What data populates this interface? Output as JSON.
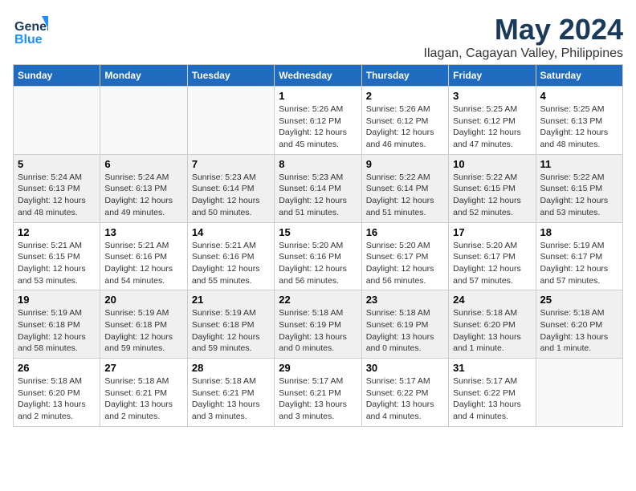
{
  "header": {
    "logo_line1": "General",
    "logo_line2": "Blue",
    "month": "May 2024",
    "location": "Ilagan, Cagayan Valley, Philippines"
  },
  "weekdays": [
    "Sunday",
    "Monday",
    "Tuesday",
    "Wednesday",
    "Thursday",
    "Friday",
    "Saturday"
  ],
  "weeks": [
    [
      {
        "day": "",
        "info": ""
      },
      {
        "day": "",
        "info": ""
      },
      {
        "day": "",
        "info": ""
      },
      {
        "day": "1",
        "info": "Sunrise: 5:26 AM\nSunset: 6:12 PM\nDaylight: 12 hours\nand 45 minutes."
      },
      {
        "day": "2",
        "info": "Sunrise: 5:26 AM\nSunset: 6:12 PM\nDaylight: 12 hours\nand 46 minutes."
      },
      {
        "day": "3",
        "info": "Sunrise: 5:25 AM\nSunset: 6:12 PM\nDaylight: 12 hours\nand 47 minutes."
      },
      {
        "day": "4",
        "info": "Sunrise: 5:25 AM\nSunset: 6:13 PM\nDaylight: 12 hours\nand 48 minutes."
      }
    ],
    [
      {
        "day": "5",
        "info": "Sunrise: 5:24 AM\nSunset: 6:13 PM\nDaylight: 12 hours\nand 48 minutes."
      },
      {
        "day": "6",
        "info": "Sunrise: 5:24 AM\nSunset: 6:13 PM\nDaylight: 12 hours\nand 49 minutes."
      },
      {
        "day": "7",
        "info": "Sunrise: 5:23 AM\nSunset: 6:14 PM\nDaylight: 12 hours\nand 50 minutes."
      },
      {
        "day": "8",
        "info": "Sunrise: 5:23 AM\nSunset: 6:14 PM\nDaylight: 12 hours\nand 51 minutes."
      },
      {
        "day": "9",
        "info": "Sunrise: 5:22 AM\nSunset: 6:14 PM\nDaylight: 12 hours\nand 51 minutes."
      },
      {
        "day": "10",
        "info": "Sunrise: 5:22 AM\nSunset: 6:15 PM\nDaylight: 12 hours\nand 52 minutes."
      },
      {
        "day": "11",
        "info": "Sunrise: 5:22 AM\nSunset: 6:15 PM\nDaylight: 12 hours\nand 53 minutes."
      }
    ],
    [
      {
        "day": "12",
        "info": "Sunrise: 5:21 AM\nSunset: 6:15 PM\nDaylight: 12 hours\nand 53 minutes."
      },
      {
        "day": "13",
        "info": "Sunrise: 5:21 AM\nSunset: 6:16 PM\nDaylight: 12 hours\nand 54 minutes."
      },
      {
        "day": "14",
        "info": "Sunrise: 5:21 AM\nSunset: 6:16 PM\nDaylight: 12 hours\nand 55 minutes."
      },
      {
        "day": "15",
        "info": "Sunrise: 5:20 AM\nSunset: 6:16 PM\nDaylight: 12 hours\nand 56 minutes."
      },
      {
        "day": "16",
        "info": "Sunrise: 5:20 AM\nSunset: 6:17 PM\nDaylight: 12 hours\nand 56 minutes."
      },
      {
        "day": "17",
        "info": "Sunrise: 5:20 AM\nSunset: 6:17 PM\nDaylight: 12 hours\nand 57 minutes."
      },
      {
        "day": "18",
        "info": "Sunrise: 5:19 AM\nSunset: 6:17 PM\nDaylight: 12 hours\nand 57 minutes."
      }
    ],
    [
      {
        "day": "19",
        "info": "Sunrise: 5:19 AM\nSunset: 6:18 PM\nDaylight: 12 hours\nand 58 minutes."
      },
      {
        "day": "20",
        "info": "Sunrise: 5:19 AM\nSunset: 6:18 PM\nDaylight: 12 hours\nand 59 minutes."
      },
      {
        "day": "21",
        "info": "Sunrise: 5:19 AM\nSunset: 6:18 PM\nDaylight: 12 hours\nand 59 minutes."
      },
      {
        "day": "22",
        "info": "Sunrise: 5:18 AM\nSunset: 6:19 PM\nDaylight: 13 hours\nand 0 minutes."
      },
      {
        "day": "23",
        "info": "Sunrise: 5:18 AM\nSunset: 6:19 PM\nDaylight: 13 hours\nand 0 minutes."
      },
      {
        "day": "24",
        "info": "Sunrise: 5:18 AM\nSunset: 6:20 PM\nDaylight: 13 hours\nand 1 minute."
      },
      {
        "day": "25",
        "info": "Sunrise: 5:18 AM\nSunset: 6:20 PM\nDaylight: 13 hours\nand 1 minute."
      }
    ],
    [
      {
        "day": "26",
        "info": "Sunrise: 5:18 AM\nSunset: 6:20 PM\nDaylight: 13 hours\nand 2 minutes."
      },
      {
        "day": "27",
        "info": "Sunrise: 5:18 AM\nSunset: 6:21 PM\nDaylight: 13 hours\nand 2 minutes."
      },
      {
        "day": "28",
        "info": "Sunrise: 5:18 AM\nSunset: 6:21 PM\nDaylight: 13 hours\nand 3 minutes."
      },
      {
        "day": "29",
        "info": "Sunrise: 5:17 AM\nSunset: 6:21 PM\nDaylight: 13 hours\nand 3 minutes."
      },
      {
        "day": "30",
        "info": "Sunrise: 5:17 AM\nSunset: 6:22 PM\nDaylight: 13 hours\nand 4 minutes."
      },
      {
        "day": "31",
        "info": "Sunrise: 5:17 AM\nSunset: 6:22 PM\nDaylight: 13 hours\nand 4 minutes."
      },
      {
        "day": "",
        "info": ""
      }
    ]
  ]
}
